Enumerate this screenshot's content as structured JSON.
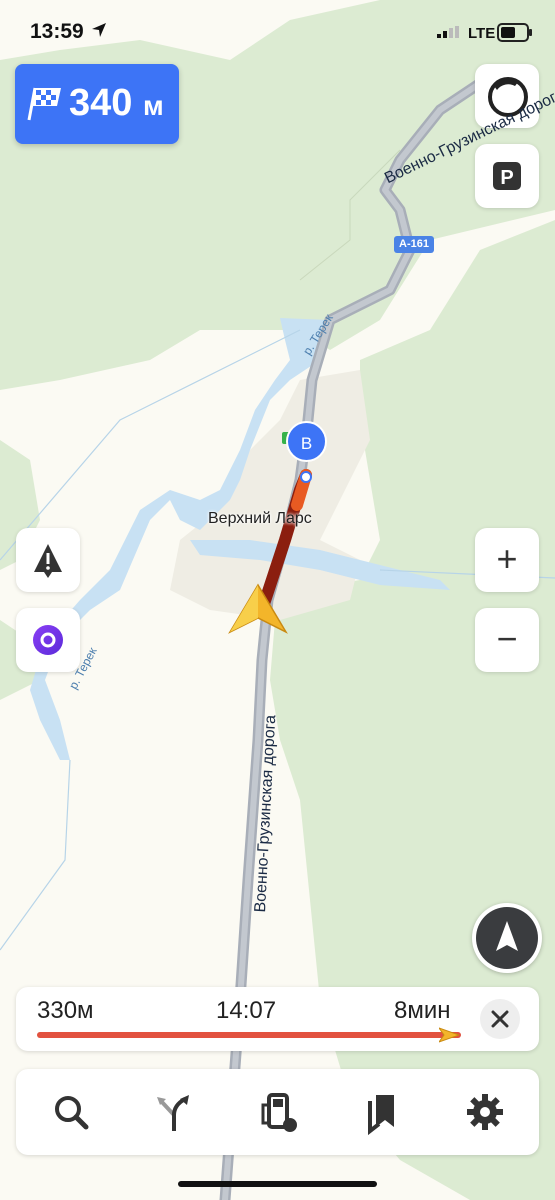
{
  "status_bar": {
    "time": "13:59",
    "network": "LTE"
  },
  "maneuver": {
    "distance_value": "340",
    "distance_unit": "м",
    "icon": "finish-flag-icon"
  },
  "map": {
    "road_label_top": "Военно-Грузинская дорога",
    "road_label_main": "Военно-Грузинская дорога",
    "road_shield": "А-161",
    "town_label": "Верхний Ларс",
    "river_label_1": "р. Терек",
    "river_label_2": "р. Терек",
    "destination_marker": "B"
  },
  "right_controls": {
    "layers_icon": "circle-layer-icon",
    "parking_label": "P",
    "zoom_in_label": "+",
    "zoom_out_label": "−"
  },
  "left_controls": {
    "incident_icon": "warning-icon",
    "assistant_icon": "alice-assistant-icon"
  },
  "route_info": {
    "distance": "330м",
    "arrival_time": "14:07",
    "duration": "8мин",
    "progress_fraction": 1.0
  },
  "toolbar": {
    "items": [
      "search-icon",
      "route-fork-icon",
      "fuel-station-icon",
      "bookmarks-icon",
      "settings-gear-icon"
    ]
  },
  "colors": {
    "accent": "#3d74f6",
    "route_dark": "#8b1e0f",
    "route_orange": "#e85a22",
    "water": "#c8e1f3",
    "forest": "#dcebd2"
  }
}
